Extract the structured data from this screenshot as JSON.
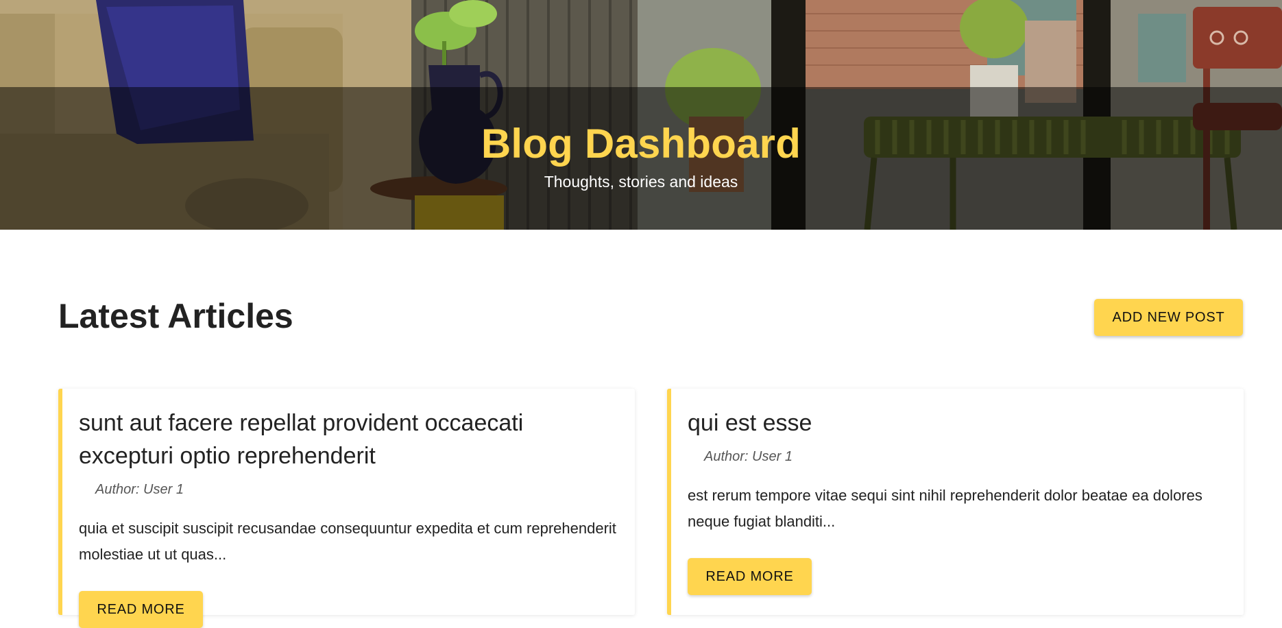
{
  "hero": {
    "title": "Blog Dashboard",
    "subtitle": "Thoughts, stories and ideas"
  },
  "main": {
    "section_title": "Latest Articles",
    "add_button_label": "ADD NEW POST"
  },
  "articles": [
    {
      "title": "sunt aut facere repellat provident occaecati excepturi optio reprehenderit",
      "author": "Author: User 1",
      "excerpt": "quia et suscipit suscipit recusandae consequuntur expedita et cum reprehenderit molestiae ut ut quas...",
      "button_label": "READ MORE"
    },
    {
      "title": "qui est esse",
      "author": "Author: User 1",
      "excerpt": "est rerum tempore vitae sequi sint nihil reprehenderit dolor beatae ea dolores neque fugiat blanditi...",
      "button_label": "READ MORE"
    }
  ],
  "colors": {
    "accent": "#ffd54f",
    "text": "#222222",
    "muted": "#555555"
  }
}
